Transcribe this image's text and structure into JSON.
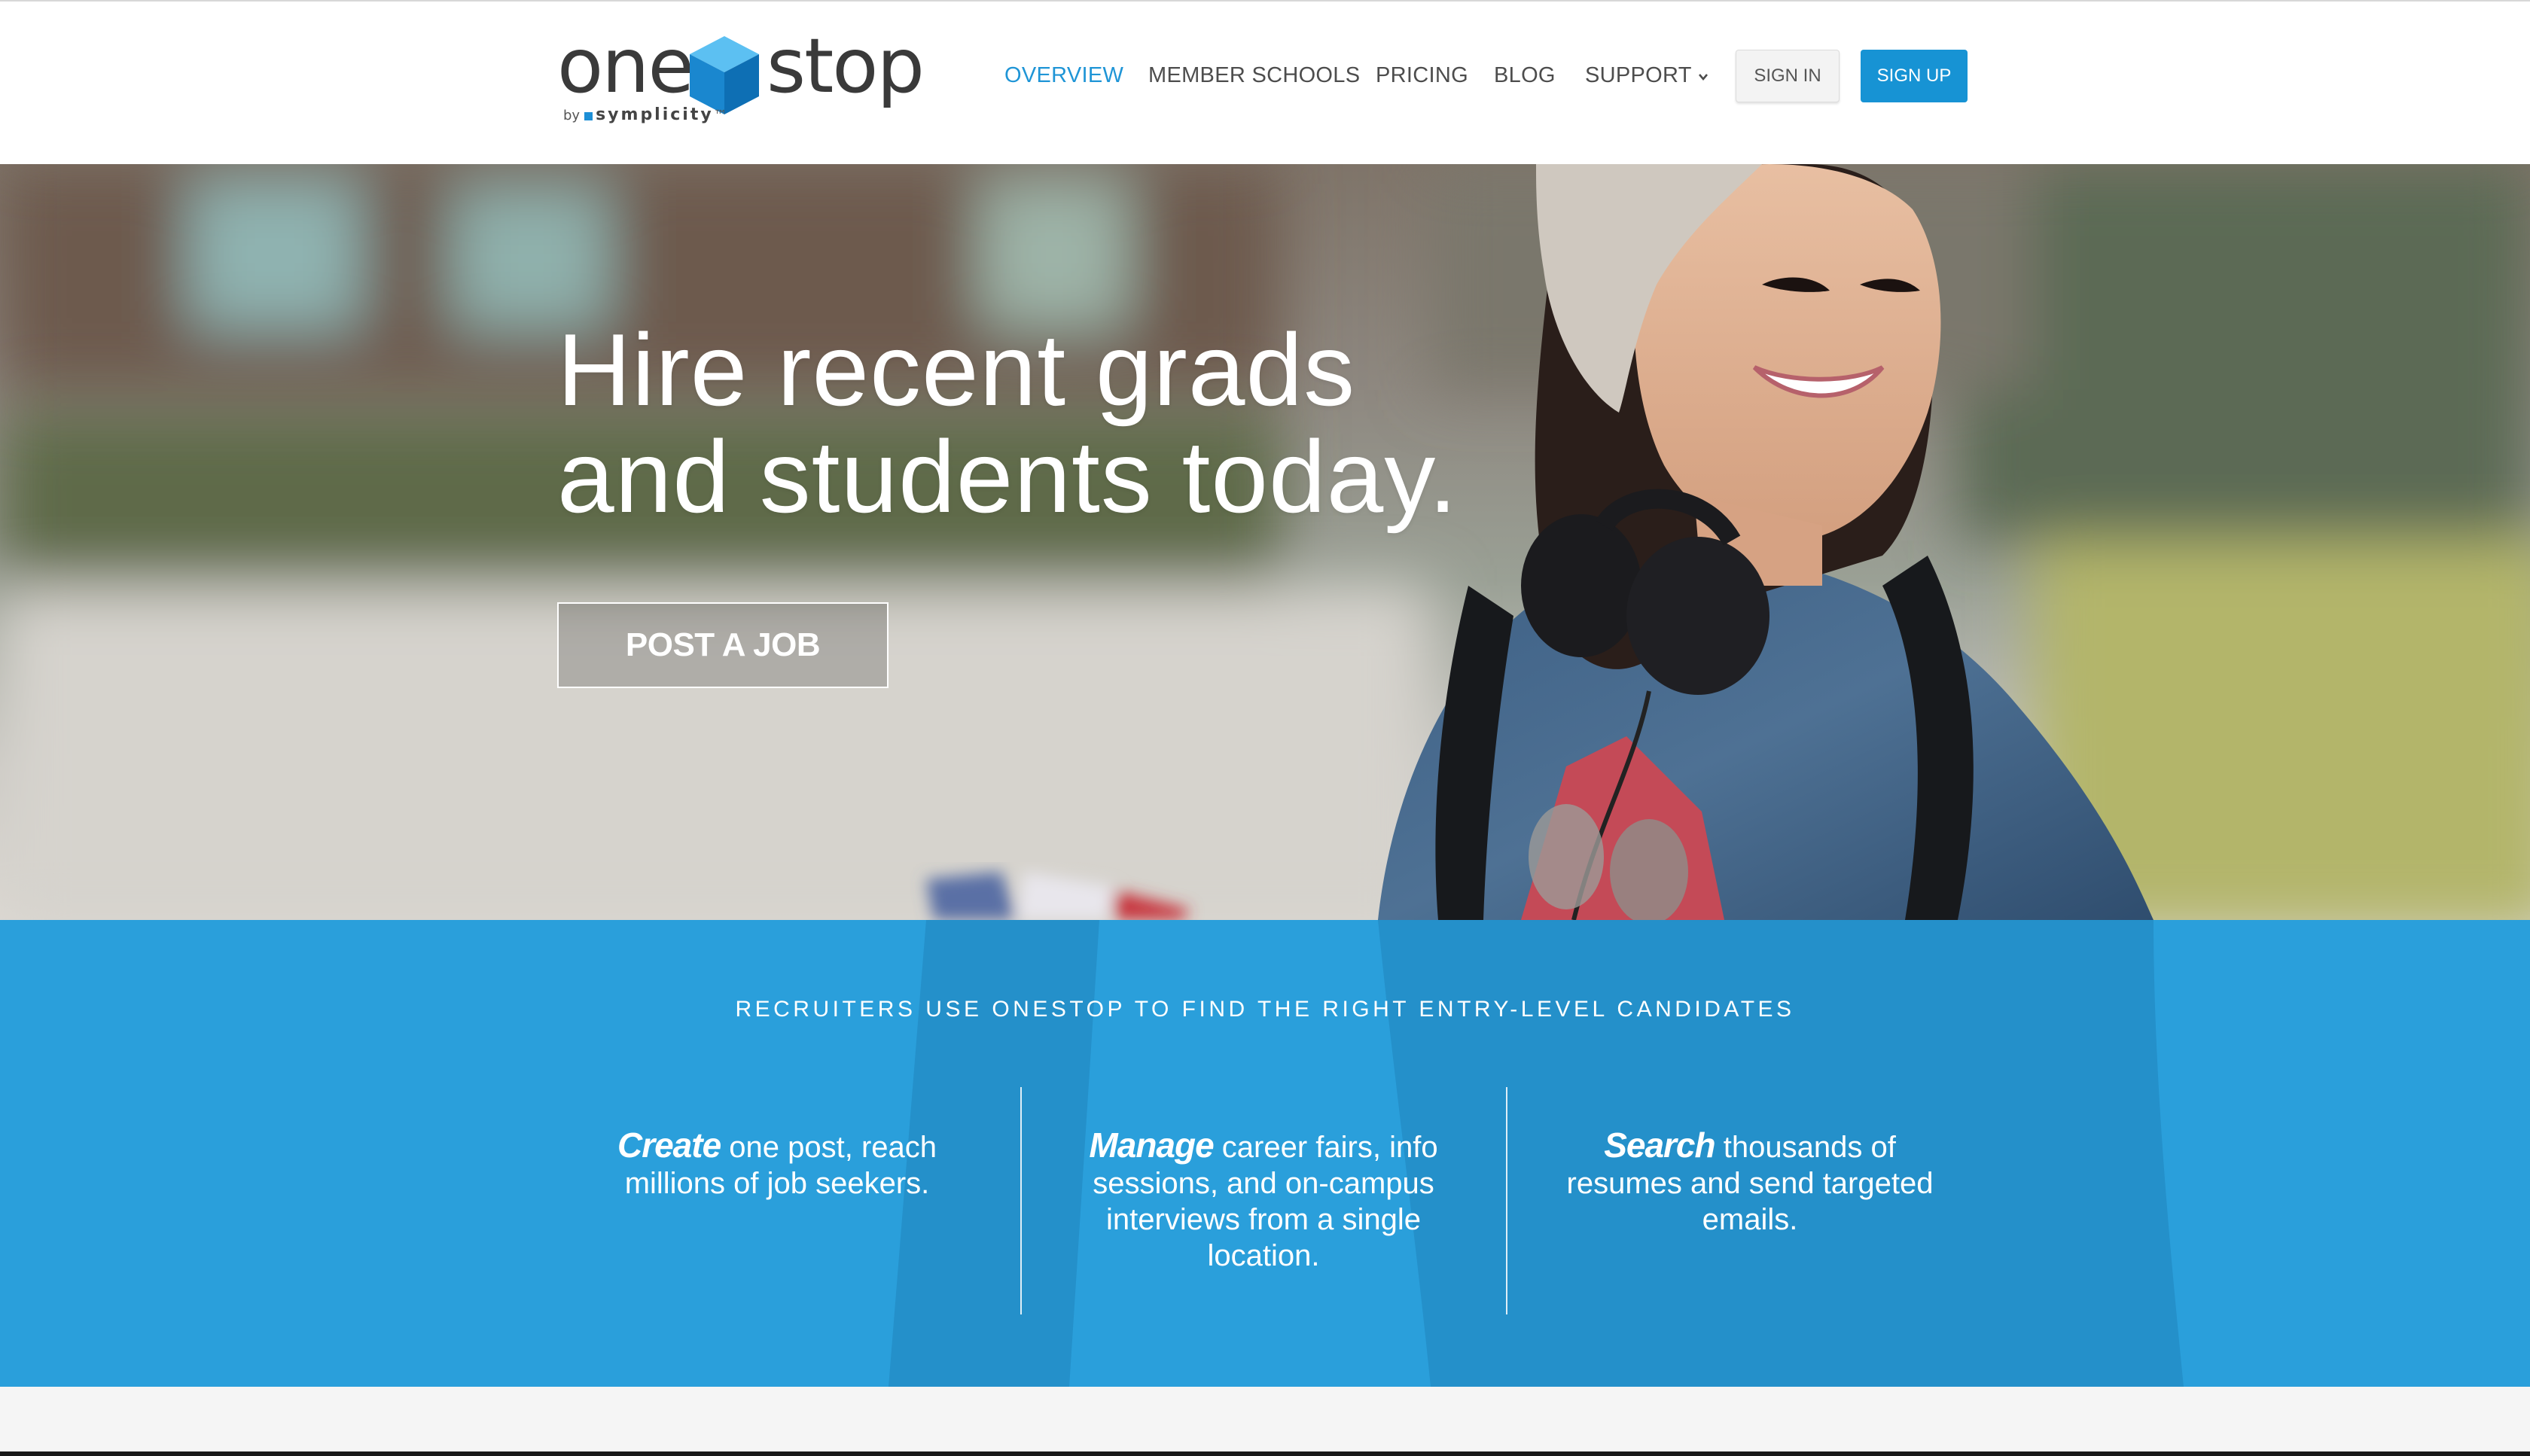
{
  "header": {
    "logo": {
      "word_left": "one",
      "word_right": "stop",
      "by": "by",
      "brand": "symplicity",
      "trademark": "™"
    },
    "nav": [
      {
        "label": "OVERVIEW",
        "active": true
      },
      {
        "label": "MEMBER SCHOOLS",
        "active": false
      },
      {
        "label": "PRICING",
        "active": false
      },
      {
        "label": "BLOG",
        "active": false
      },
      {
        "label": "SUPPORT",
        "active": false,
        "icon": "chevron-down-icon"
      }
    ],
    "signin_label": "SIGN IN",
    "signup_label": "SIGN UP"
  },
  "hero": {
    "title_line1": "Hire recent grads",
    "title_line2": "and students today.",
    "cta_label": "POST A JOB"
  },
  "band": {
    "heading": "RECRUITERS USE ONESTOP TO FIND THE RIGHT ENTRY-LEVEL CANDIDATES",
    "features": [
      {
        "keyword": "Create",
        "text": " one post, reach millions of job seekers."
      },
      {
        "keyword": "Manage",
        "text": " career fairs, info sessions, and on-campus interviews from a single location."
      },
      {
        "keyword": "Search",
        "text": " thousands of resumes and send targeted emails."
      }
    ]
  },
  "colors": {
    "accent": "#1793d4",
    "band": "#2a9fdb",
    "nav_active": "#1f95d6",
    "text_dark": "#4d4d4d"
  }
}
